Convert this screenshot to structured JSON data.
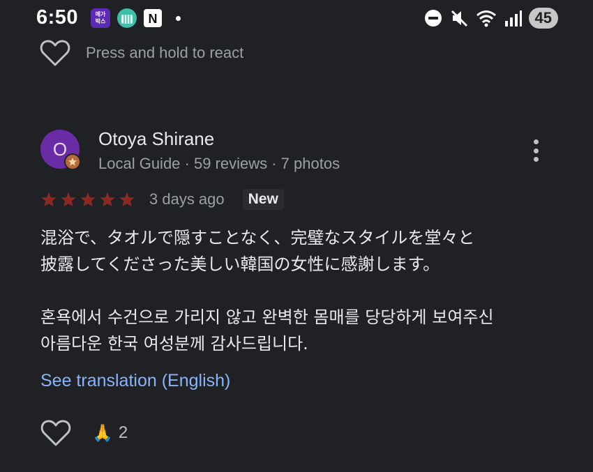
{
  "status_bar": {
    "time": "6:50",
    "app_icons": [
      {
        "name": "megabox-app-icon",
        "label": "메가\n박스",
        "color": "#5b2bb5"
      },
      {
        "name": "teal-app-icon",
        "color": "#3fbfa8"
      },
      {
        "name": "n-app-icon",
        "label": "N",
        "color": "#ffffff"
      }
    ],
    "battery_level": "45"
  },
  "reaction_prompt": {
    "text": "Press and hold to react"
  },
  "review": {
    "avatar_initial": "O",
    "avatar_color": "#6a2ca6",
    "reviewer_name": "Otoya Shirane",
    "reviewer_meta": "Local Guide · 59 reviews · 7 photos",
    "rating": 5,
    "star_color": "#8a2a22",
    "date": "3 days ago",
    "badge": "New",
    "paragraph_ja": "混浴で、タオルで隠すことなく、完璧なスタイルを堂々と\n披露してくださった美しい韓国の女性に感謝します。",
    "paragraph_ko": "혼욕에서 수건으로 가리지 않고 완벽한 몸매를 당당하게 보여주신\n아름다운 한국 여성분께 감사드립니다.",
    "translate_link": "See translation (English)",
    "link_color": "#8ab4f8"
  },
  "reactions": {
    "emoji": "🙏",
    "count": "2"
  }
}
